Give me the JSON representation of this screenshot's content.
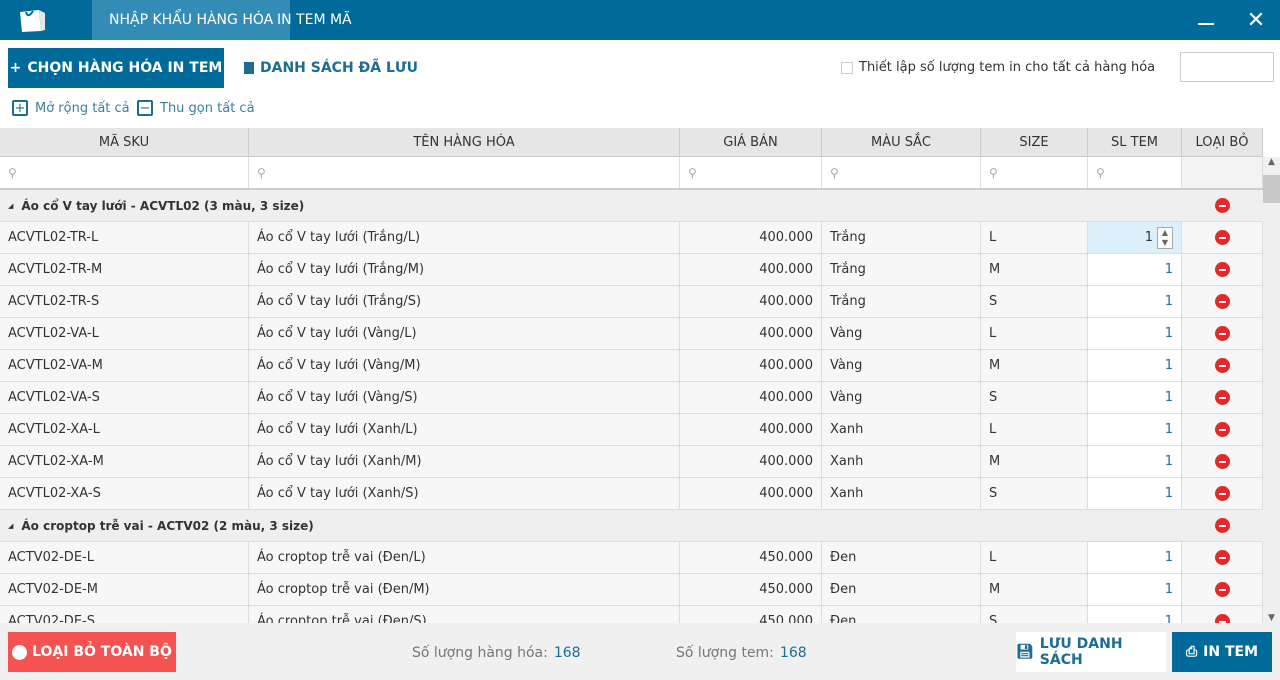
{
  "topbar": {
    "tabs": [
      {
        "label": "NHẬP KHẨU HÀNG HÓA",
        "active": true
      },
      {
        "label": "IN TEM MÃ",
        "active": false
      }
    ],
    "minimize_icon": "minimize-icon",
    "close_icon": "close-icon"
  },
  "toolbar": {
    "choose_label": "CHỌN HÀNG HÓA IN TEM",
    "saved_list_label": "DANH SÁCH ĐÃ LƯU",
    "set_all_label": "Thiết lập số lượng tem in cho tất cả hàng hóa",
    "set_all_value": "",
    "expand_all": "Mở rộng tất cả",
    "collapse_all": "Thu gọn tất cả"
  },
  "columns": [
    "MÃ SKU",
    "TÊN HÀNG HÓA",
    "GIÁ BÁN",
    "MÀU SẮC",
    "SIZE",
    "SL TEM",
    "LOẠI BỎ"
  ],
  "groups": [
    {
      "title": "Áo cổ V tay lưới - ACVTL02 (3 màu, 3 size)",
      "rows": [
        [
          "ACVTL02-TR-L",
          "Áo cổ V tay lưới (Trắng/L)",
          "400.000",
          "Trắng",
          "L",
          "1"
        ],
        [
          "ACVTL02-TR-M",
          "Áo cổ V tay lưới (Trắng/M)",
          "400.000",
          "Trắng",
          "M",
          "1"
        ],
        [
          "ACVTL02-TR-S",
          "Áo cổ V tay lưới (Trắng/S)",
          "400.000",
          "Trắng",
          "S",
          "1"
        ],
        [
          "ACVTL02-VA-L",
          "Áo cổ V tay lưới (Vàng/L)",
          "400.000",
          "Vàng",
          "L",
          "1"
        ],
        [
          "ACVTL02-VA-M",
          "Áo cổ V tay lưới (Vàng/M)",
          "400.000",
          "Vàng",
          "M",
          "1"
        ],
        [
          "ACVTL02-VA-S",
          "Áo cổ V tay lưới (Vàng/S)",
          "400.000",
          "Vàng",
          "S",
          "1"
        ],
        [
          "ACVTL02-XA-L",
          "Áo cổ V tay lưới (Xanh/L)",
          "400.000",
          "Xanh",
          "L",
          "1"
        ],
        [
          "ACVTL02-XA-M",
          "Áo cổ V tay lưới (Xanh/M)",
          "400.000",
          "Xanh",
          "M",
          "1"
        ],
        [
          "ACVTL02-XA-S",
          "Áo cổ V tay lưới (Xanh/S)",
          "400.000",
          "Xanh",
          "S",
          "1"
        ]
      ]
    },
    {
      "title": "Áo croptop trễ vai - ACTV02 (2 màu, 3 size)",
      "rows": [
        [
          "ACTV02-DE-L",
          "Áo croptop trễ vai (Đen/L)",
          "450.000",
          "Đen",
          "L",
          "1"
        ],
        [
          "ACTV02-DE-M",
          "Áo croptop trễ vai (Đen/M)",
          "450.000",
          "Đen",
          "M",
          "1"
        ],
        [
          "ACTV02-DE-S",
          "Áo croptop trễ vai (Đen/S)",
          "450.000",
          "Đen",
          "S",
          "1"
        ]
      ]
    }
  ],
  "footer": {
    "remove_all_label": "LOẠI BỎ TOÀN BỘ",
    "item_count_label": "Số lượng hàng hóa:",
    "item_count": "168",
    "label_count_label": "Số lượng tem:",
    "label_count": "168",
    "save_label": "LƯU DANH SÁCH",
    "print_label": "IN TEM"
  },
  "colors": {
    "primary": "#006b9b",
    "danger": "#f55252",
    "remove_icon": "#e5282e"
  }
}
